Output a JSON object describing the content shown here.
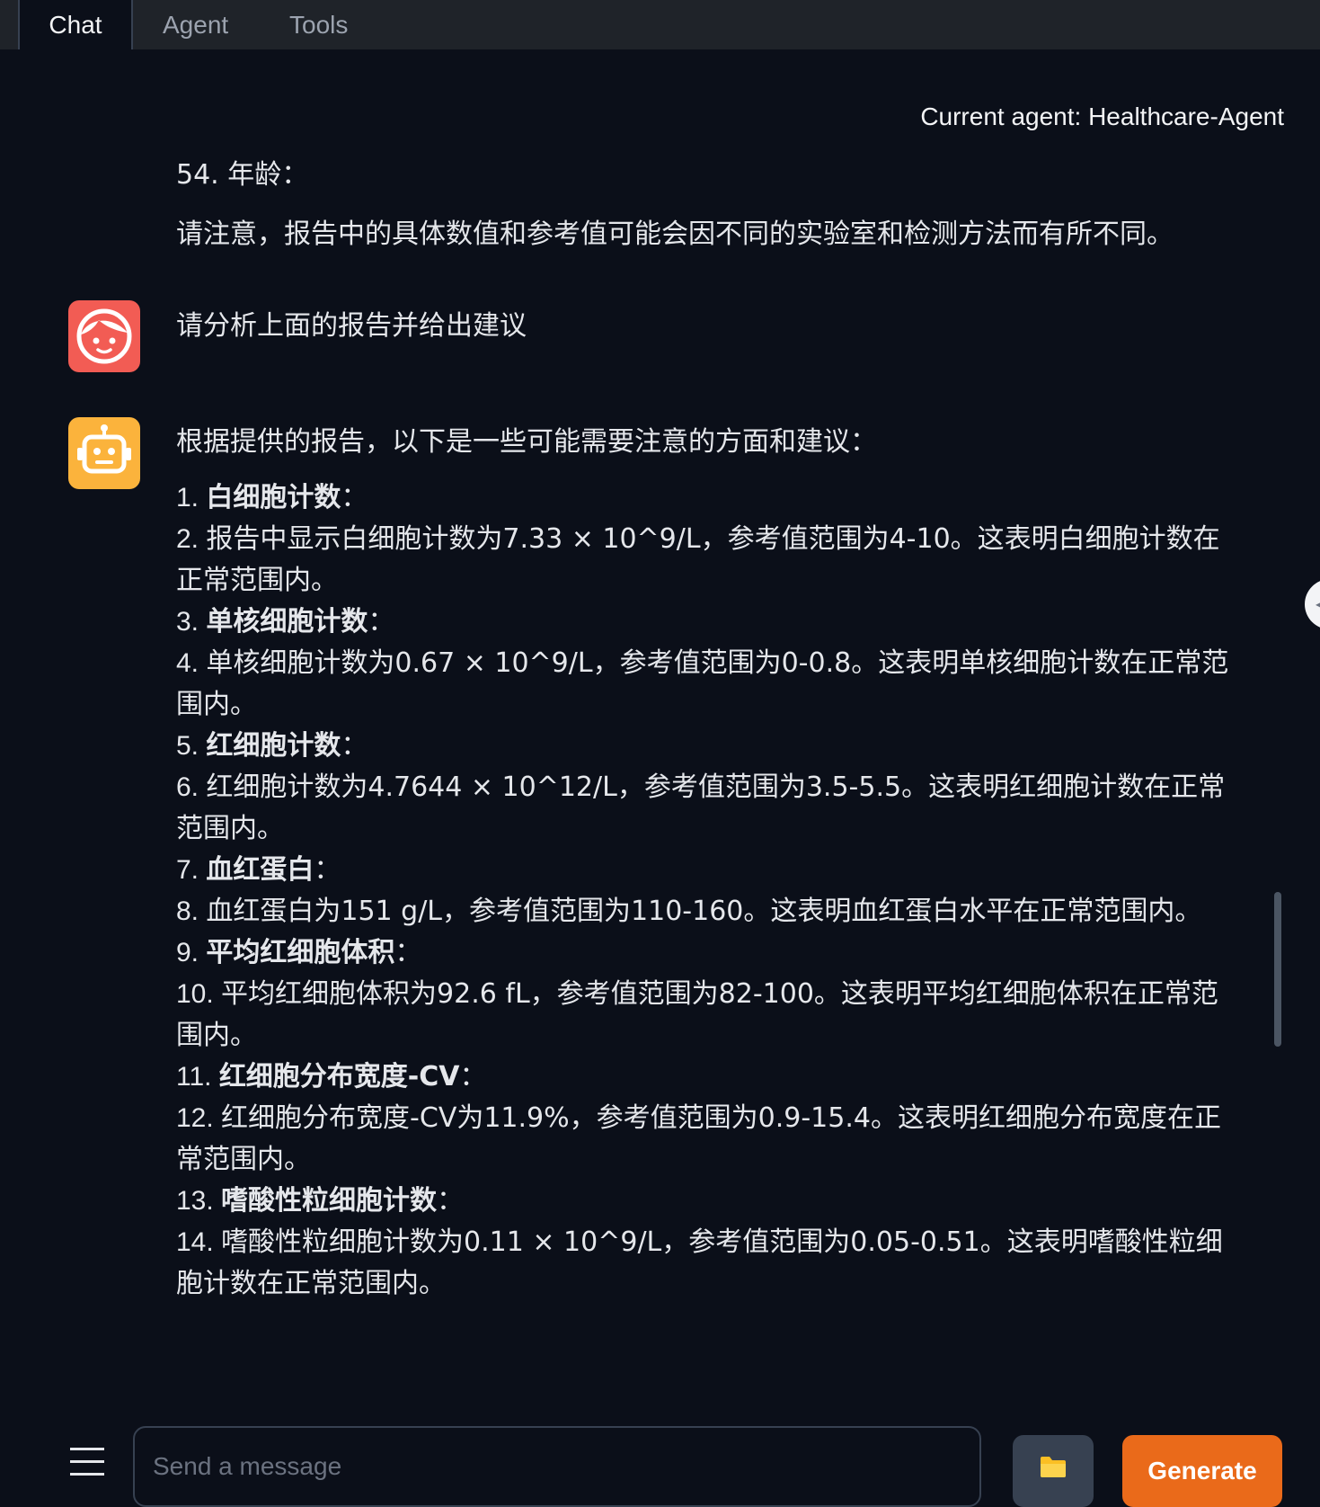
{
  "tabs": [
    {
      "label": "Chat",
      "active": true
    },
    {
      "label": "Agent",
      "active": false
    },
    {
      "label": "Tools",
      "active": false
    }
  ],
  "agent_label": "Current agent: Healthcare-Agent",
  "previous_message": {
    "line1": "54. 年龄：",
    "line2": "请注意，报告中的具体数值和参考值可能会因不同的实验室和检测方法而有所不同。"
  },
  "user_message": {
    "avatar_icon": "user-face-icon",
    "avatar_color": "#f25c54",
    "text": "请分析上面的报告并给出建议"
  },
  "bot_message": {
    "avatar_icon": "robot-icon",
    "avatar_color": "#fbb33c",
    "intro": "根据提供的报告，以下是一些可能需要注意的方面和建议：",
    "items": [
      {
        "num": "1. ",
        "bold": "白细胞计数",
        "rest": "："
      },
      {
        "num": "2. ",
        "bold": "",
        "rest": "报告中显示白细胞计数为7.33 × 10^9/L，参考值范围为4-10。这表明白细胞计数在正常范围内。"
      },
      {
        "num": "3. ",
        "bold": "单核细胞计数",
        "rest": "："
      },
      {
        "num": "4. ",
        "bold": "",
        "rest": "单核细胞计数为0.67 × 10^9/L，参考值范围为0-0.8。这表明单核细胞计数在正常范围内。"
      },
      {
        "num": "5. ",
        "bold": "红细胞计数",
        "rest": "："
      },
      {
        "num": "6. ",
        "bold": "",
        "rest": "红细胞计数为4.7644 × 10^12/L，参考值范围为3.5-5.5。这表明红细胞计数在正常范围内。"
      },
      {
        "num": "7. ",
        "bold": "血红蛋白",
        "rest": "："
      },
      {
        "num": "8. ",
        "bold": "",
        "rest": "血红蛋白为151 g/L，参考值范围为110-160。这表明血红蛋白水平在正常范围内。"
      },
      {
        "num": "9. ",
        "bold": "平均红细胞体积",
        "rest": "："
      },
      {
        "num": "10. ",
        "bold": "",
        "rest": "平均红细胞体积为92.6 fL，参考值范围为82-100。这表明平均红细胞体积在正常范围内。"
      },
      {
        "num": "11. ",
        "bold": "红细胞分布宽度-CV",
        "rest": "："
      },
      {
        "num": "12. ",
        "bold": "",
        "rest": "红细胞分布宽度-CV为11.9%，参考值范围为0.9-15.4。这表明红细胞分布宽度在正常范围内。"
      },
      {
        "num": "13. ",
        "bold": "嗜酸性粒细胞计数",
        "rest": "："
      },
      {
        "num": "14. ",
        "bold": "",
        "rest": "嗜酸性粒细胞计数为0.11 × 10^9/L，参考值范围为0.05-0.51。这表明嗜酸性粒细胞计数在正常范围内。"
      }
    ]
  },
  "input": {
    "placeholder": "Send a message",
    "value": ""
  },
  "buttons": {
    "menu_icon": "hamburger-menu-icon",
    "folder_icon": "folder-icon",
    "generate_label": "Generate"
  },
  "colors": {
    "background": "#0b0f19",
    "tabbar": "#1f2329",
    "accent": "#ea6a1a"
  }
}
